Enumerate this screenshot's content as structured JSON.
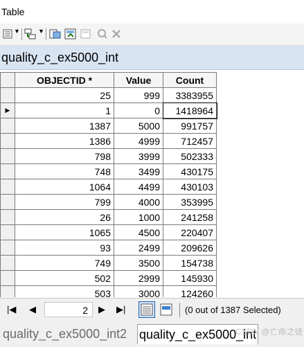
{
  "window": {
    "title": "Table"
  },
  "table_name": "quality_c_ex5000_int",
  "columns": [
    "OBJECTID *",
    "Value",
    "Count"
  ],
  "rows": [
    {
      "objectid": "25",
      "value": "999",
      "count": "3383955"
    },
    {
      "objectid": "1",
      "value": "0",
      "count": "1418964",
      "current": true
    },
    {
      "objectid": "1387",
      "value": "5000",
      "count": "991757"
    },
    {
      "objectid": "1386",
      "value": "4999",
      "count": "712457"
    },
    {
      "objectid": "798",
      "value": "3999",
      "count": "502333"
    },
    {
      "objectid": "748",
      "value": "3499",
      "count": "430175"
    },
    {
      "objectid": "1064",
      "value": "4499",
      "count": "430103"
    },
    {
      "objectid": "799",
      "value": "4000",
      "count": "353995"
    },
    {
      "objectid": "26",
      "value": "1000",
      "count": "241258"
    },
    {
      "objectid": "1065",
      "value": "4500",
      "count": "220407"
    },
    {
      "objectid": "93",
      "value": "2499",
      "count": "209626"
    },
    {
      "objectid": "749",
      "value": "3500",
      "count": "154738"
    },
    {
      "objectid": "502",
      "value": "2999",
      "count": "145930"
    },
    {
      "objectid": "503",
      "value": "3000",
      "count": "124260"
    }
  ],
  "navigation": {
    "current_record": "2",
    "status": "(0 out of 1387 Selected)"
  },
  "tabs": [
    {
      "label": "quality_c_ex5000_int2",
      "active": false
    },
    {
      "label": "quality_c_ex5000_int",
      "active": true
    }
  ],
  "watermark": "CSDN @亡命之徒",
  "icons": {
    "toolbar": [
      "table-options-icon",
      "related-tables-icon",
      "select-by-attributes-icon",
      "switch-selection-icon",
      "clear-selection-icon",
      "zoom-to-selected-icon",
      "delete-selected-icon"
    ],
    "row_pointer": "row-pointer-icon"
  },
  "colors": {
    "tab_title_bg": "#d9e4f2",
    "grid_border": "#7a7a7a",
    "view_button_accent": "#1f5fa8"
  }
}
